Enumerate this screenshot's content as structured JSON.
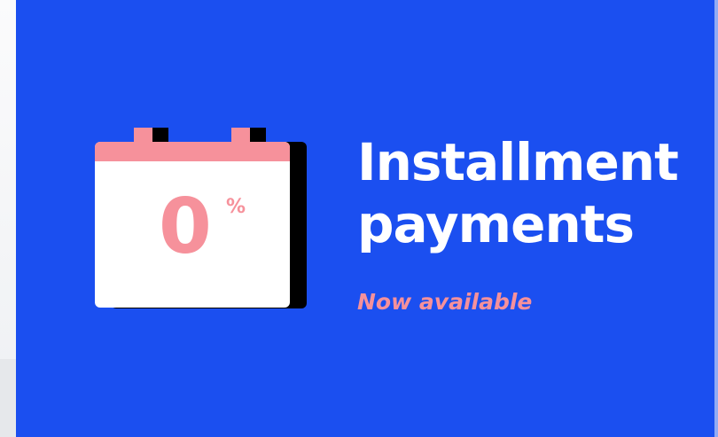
{
  "banner": {
    "headline_line1": "Installment",
    "headline_line2": "payments",
    "subtitle": "Now available"
  },
  "calendar": {
    "value": "0",
    "unit": "%"
  },
  "colors": {
    "banner_bg": "#1b4ff0",
    "accent_pink": "#f6919b",
    "text_white": "#ffffff",
    "shadow_black": "#000000"
  },
  "icons": {
    "calendar": "calendar-icon"
  }
}
